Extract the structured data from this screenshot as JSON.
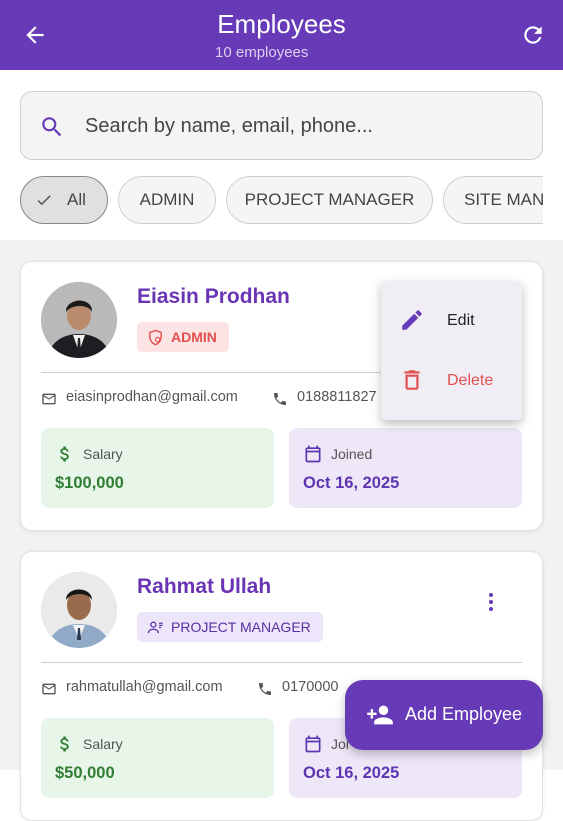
{
  "appbar": {
    "title": "Employees",
    "subtitle": "10 employees",
    "back_icon": "arrow-back-icon",
    "refresh_icon": "refresh-icon"
  },
  "search": {
    "placeholder": "Search by name, email, phone...",
    "icon": "search-icon"
  },
  "filters": {
    "chips": [
      "All",
      "ADMIN",
      "PROJECT MANAGER",
      "SITE MAN"
    ],
    "selected": "All"
  },
  "employees": [
    {
      "name": "Eiasin Prodhan",
      "role": "ADMIN",
      "email": "eiasinprodhan@gmail.com",
      "phone": "0188811827",
      "salary_label": "Salary",
      "salary": "$100,000",
      "joined_label": "Joined",
      "joined": "Oct 16, 2025"
    },
    {
      "name": "Rahmat Ullah",
      "role": "PROJECT MANAGER",
      "email": "rahmatullah@gmail.com",
      "phone": "0170000",
      "salary_label": "Salary",
      "salary": "$50,000",
      "joined_label": "Joi",
      "joined": "Oct 16, 2025"
    }
  ],
  "context_menu": {
    "edit_label": "Edit",
    "delete_label": "Delete"
  },
  "fab": {
    "label": "Add Employee",
    "icon": "person-add-icon"
  },
  "colors": {
    "primary": "#673ab7",
    "admin_badge_bg": "#fde4e4",
    "admin_badge_fg": "#e35050",
    "pm_badge_bg": "#ede5f9",
    "pm_badge_fg": "#5b2ea3",
    "salary_bg": "#e8f5e9",
    "salary_fg": "#2e7d32",
    "joined_bg": "#ede7f8",
    "joined_fg": "#5e35b1",
    "delete_fg": "#e35050"
  }
}
